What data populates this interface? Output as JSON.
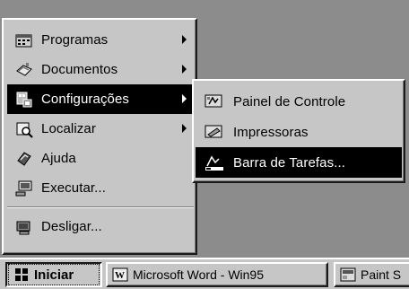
{
  "start_menu": {
    "items": [
      {
        "label": "Programas",
        "icon": "programs-icon",
        "has_submenu": true
      },
      {
        "label": "Documentos",
        "icon": "documents-icon",
        "has_submenu": true
      },
      {
        "label": "Configurações",
        "icon": "settings-icon",
        "has_submenu": true,
        "active": true
      },
      {
        "label": "Localizar",
        "icon": "find-icon",
        "has_submenu": true
      },
      {
        "label": "Ajuda",
        "icon": "help-icon",
        "has_submenu": false
      },
      {
        "label": "Executar...",
        "icon": "run-icon",
        "has_submenu": false
      },
      {
        "label": "Desligar...",
        "icon": "shutdown-icon",
        "has_submenu": false
      }
    ]
  },
  "submenu": {
    "items": [
      {
        "label": "Painel de Controle",
        "icon": "control-panel-icon"
      },
      {
        "label": "Impressoras",
        "icon": "printers-icon"
      },
      {
        "label": "Barra de Tarefas...",
        "icon": "taskbar-icon",
        "active": true
      }
    ]
  },
  "taskbar": {
    "start_label": "Iniciar",
    "buttons": [
      {
        "label": "Microsoft Word - Win95",
        "icon": "word-icon"
      },
      {
        "label": "Paint S",
        "icon": "paint-icon"
      }
    ]
  },
  "colors": {
    "face": "#c6c6c6",
    "desktop": "#8c8c8c",
    "highlight": "#000000",
    "highlight_text": "#ffffff"
  }
}
